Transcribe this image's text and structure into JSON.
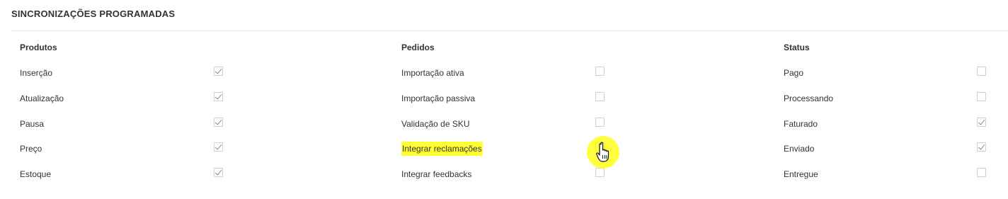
{
  "section": {
    "title": "SINCRONIZAÇÕES PROGRAMADAS"
  },
  "columns": [
    {
      "header": "Produtos",
      "items": [
        {
          "label": "Inserção",
          "checked": true
        },
        {
          "label": "Atualização",
          "checked": true
        },
        {
          "label": "Pausa",
          "checked": true
        },
        {
          "label": "Preço",
          "checked": true
        },
        {
          "label": "Estoque",
          "checked": true
        }
      ]
    },
    {
      "header": "Pedidos",
      "items": [
        {
          "label": "Importação ativa",
          "checked": false
        },
        {
          "label": "Importação passiva",
          "checked": false
        },
        {
          "label": "Validação de SKU",
          "checked": false
        },
        {
          "label": "Integrar reclamações",
          "checked": false,
          "highlighted": true
        },
        {
          "label": "Integrar feedbacks",
          "checked": false
        }
      ]
    },
    {
      "header": "Status",
      "items": [
        {
          "label": "Pago",
          "checked": false
        },
        {
          "label": "Processando",
          "checked": false
        },
        {
          "label": "Faturado",
          "checked": true
        },
        {
          "label": "Enviado",
          "checked": true
        },
        {
          "label": "Entregue",
          "checked": false
        }
      ]
    }
  ],
  "colors": {
    "highlight": "#ffff33",
    "cursor_halo": "#ffff00",
    "checkbox_border": "#cfcfcf",
    "tick": "#8a8a8a"
  },
  "icons": {
    "cursor": "hand-pointer-icon",
    "checkmark": "checkmark-icon"
  }
}
